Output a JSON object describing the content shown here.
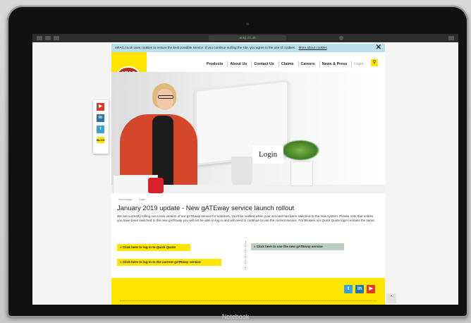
{
  "browser": {
    "url": "arag.co.uk"
  },
  "cookie_bar": {
    "text": "ARAG.co.uk uses cookies to ensure the best possible service. If you continue surfing the site, you agree to the use of cookies.",
    "link": "More about cookies",
    "close": "✕"
  },
  "header": {
    "logo_text": "ARAG",
    "nav": [
      "Products",
      "About Us",
      "Contact Us",
      "Claims",
      "Careers",
      "News & Press",
      "Login"
    ],
    "search_icon": "search-icon"
  },
  "hero": {
    "label": "Login"
  },
  "share_rail": {
    "items": [
      "youtube-icon",
      "linkedin-icon",
      "twitter-icon",
      "share-plus-icon"
    ],
    "plus_label": "BLOG"
  },
  "breadcrumb": [
    "Homepage",
    "Login"
  ],
  "main": {
    "headline": "January 2019 update - New gATEway service launch rollout",
    "intro": "We are currently rolling out a new version of our gATEway service for solicitors. You'll be notified when your account has been switched to the new system. Please note that unless you have been switched to the new gATEway you will not be able to log in and will need to continue to use the current service. For Brokers our Quick Quote login remains the same.",
    "cta_quick_quote": "» Click here to log in to Quick Quote",
    "cta_current_gateway": "» Click here to log in to the current gATEway service",
    "cta_new_gateway": "» Click here to use the new gATEway service"
  },
  "footer": {
    "icons": [
      "twitter-icon",
      "linkedin-icon",
      "youtube-icon"
    ]
  },
  "device": {
    "label": "Notebook"
  },
  "colors": {
    "brand_yellow": "#ffe500",
    "brand_red": "#b22f17",
    "cookie_bar": "#b9e0ec",
    "secondary_button": "#b9cfc0"
  }
}
